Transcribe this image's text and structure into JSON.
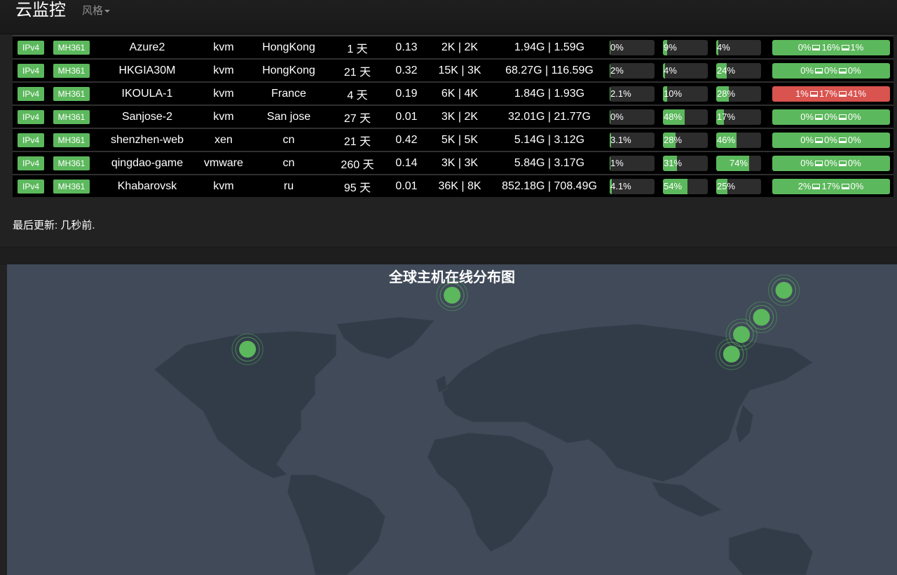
{
  "header": {
    "brand": "云监控",
    "style_menu": "风格"
  },
  "servers": [
    {
      "ipv": "IPv4",
      "tag": "MH361",
      "name": "Azure2",
      "type": "kvm",
      "location": "HongKong",
      "uptime": "1 天",
      "load": "0.13",
      "network": "2K | 2K",
      "traffic": "1.94G | 1.59G",
      "cpu": "0%",
      "cpu_pct": 0,
      "ram": "9%",
      "ram_pct": 9,
      "hdd": "4%",
      "hdd_pct": 4,
      "status": {
        "a": "0%",
        "b": "16%",
        "c": "1%",
        "state": "ok"
      }
    },
    {
      "ipv": "IPv4",
      "tag": "MH361",
      "name": "HKGIA30M",
      "type": "kvm",
      "location": "HongKong",
      "uptime": "21 天",
      "load": "0.32",
      "network": "15K | 3K",
      "traffic": "68.27G | 116.59G",
      "cpu": "2%",
      "cpu_pct": 2,
      "ram": "4%",
      "ram_pct": 4,
      "hdd": "24%",
      "hdd_pct": 24,
      "status": {
        "a": "0%",
        "b": "0%",
        "c": "0%",
        "state": "ok"
      }
    },
    {
      "ipv": "IPv4",
      "tag": "MH361",
      "name": "IKOULA-1",
      "type": "kvm",
      "location": "France",
      "uptime": "4 天",
      "load": "0.19",
      "network": "6K | 4K",
      "traffic": "1.84G | 1.93G",
      "cpu": "2.1%",
      "cpu_pct": 2.1,
      "ram": "10%",
      "ram_pct": 10,
      "hdd": "28%",
      "hdd_pct": 28,
      "status": {
        "a": "1%",
        "b": "17%",
        "c": "41%",
        "state": "danger"
      }
    },
    {
      "ipv": "IPv4",
      "tag": "MH361",
      "name": "Sanjose-2",
      "type": "kvm",
      "location": "San jose",
      "uptime": "27 天",
      "load": "0.01",
      "network": "3K | 2K",
      "traffic": "32.01G | 21.77G",
      "cpu": "0%",
      "cpu_pct": 0,
      "ram": "48%",
      "ram_pct": 48,
      "hdd": "17%",
      "hdd_pct": 17,
      "status": {
        "a": "0%",
        "b": "0%",
        "c": "0%",
        "state": "ok"
      }
    },
    {
      "ipv": "IPv4",
      "tag": "MH361",
      "name": "shenzhen-web",
      "type": "xen",
      "location": "cn",
      "uptime": "21 天",
      "load": "0.42",
      "network": "5K | 5K",
      "traffic": "5.14G | 3.12G",
      "cpu": "3.1%",
      "cpu_pct": 3.1,
      "ram": "28%",
      "ram_pct": 28,
      "hdd": "46%",
      "hdd_pct": 46,
      "status": {
        "a": "0%",
        "b": "0%",
        "c": "0%",
        "state": "ok"
      }
    },
    {
      "ipv": "IPv4",
      "tag": "MH361",
      "name": "qingdao-game",
      "type": "vmware",
      "location": "cn",
      "uptime": "260 天",
      "load": "0.14",
      "network": "3K | 3K",
      "traffic": "5.84G | 3.17G",
      "cpu": "1%",
      "cpu_pct": 1,
      "ram": "31%",
      "ram_pct": 31,
      "hdd": "74%",
      "hdd_pct": 74,
      "status": {
        "a": "0%",
        "b": "0%",
        "c": "0%",
        "state": "ok"
      }
    },
    {
      "ipv": "IPv4",
      "tag": "MH361",
      "name": "Khabarovsk",
      "type": "kvm",
      "location": "ru",
      "uptime": "95 天",
      "load": "0.01",
      "network": "36K | 8K",
      "traffic": "852.18G | 708.49G",
      "cpu": "4.1%",
      "cpu_pct": 4.1,
      "ram": "54%",
      "ram_pct": 54,
      "hdd": "25%",
      "hdd_pct": 25,
      "status": {
        "a": "2%",
        "b": "17%",
        "c": "0%",
        "state": "ok"
      }
    }
  ],
  "last_update": "最后更新: 几秒前.",
  "map": {
    "title": "全球主机在线分布图",
    "marker_color": "#5cb85c",
    "points": [
      {
        "name": "San jose",
        "lon": -80,
        "lat": 24
      },
      {
        "name": "France",
        "lon": 2,
        "lat": 46
      },
      {
        "name": "Khabarovsk",
        "lon": 135,
        "lat": 48
      },
      {
        "name": "qingdao-game",
        "lon": 126,
        "lat": 37
      },
      {
        "name": "HongKong",
        "lon": 118,
        "lat": 30
      },
      {
        "name": "shenzhen-web",
        "lon": 114,
        "lat": 22
      }
    ]
  }
}
